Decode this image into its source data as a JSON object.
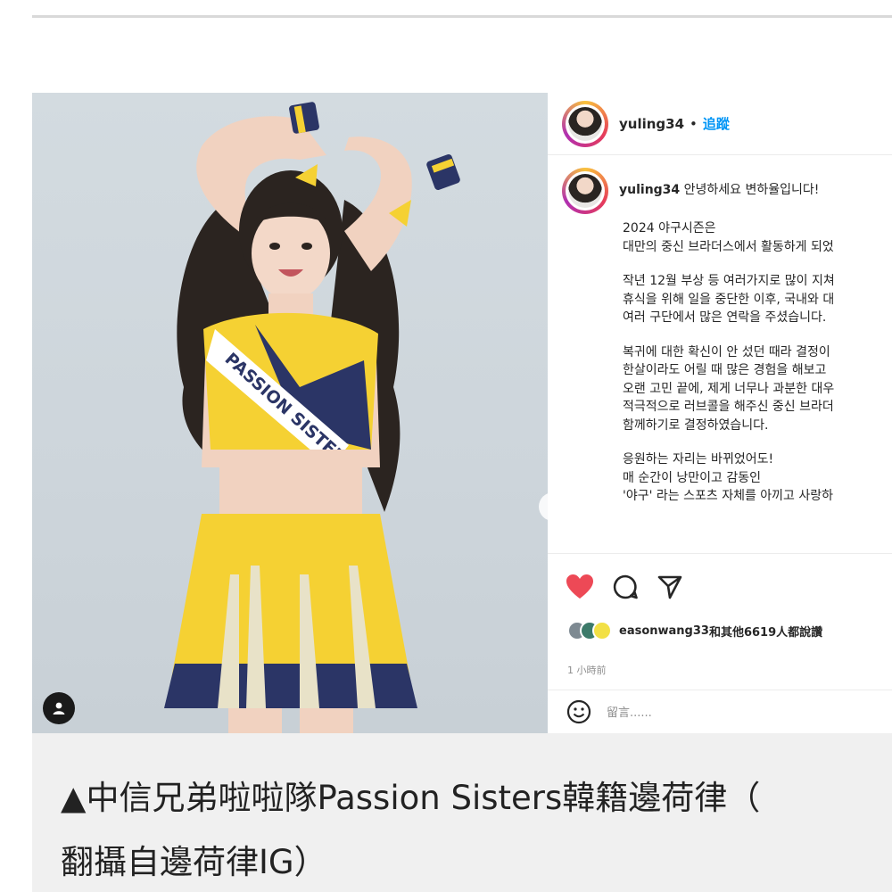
{
  "post": {
    "username": "yuling34",
    "separator": "•",
    "follow_label": "追蹤",
    "caption_greeting": "안녕하세요 변하율입니다!",
    "caption_paragraphs": [
      [
        "2024 야구시즌은",
        "대만의 중신 브라더스에서 활동하게 되었"
      ],
      [
        "작년 12월 부상 등 여러가지로 많이 지쳐",
        "휴식을 위해 일을 중단한 이후, 국내와 대",
        "여러 구단에서 많은 연락을 주셨습니다."
      ],
      [
        "복귀에 대한 확신이 안 섰던 때라 결정이",
        "한살이라도 어릴 때 많은 경험을 해보고",
        "오랜 고민 끝에, 제게 너무나 과분한 대우",
        "적극적으로 러브콜을 해주신 중신 브라더",
        "함께하기로 결정하였습니다."
      ],
      [
        "응원하는 자리는 바뀌었어도!",
        "매 순간이 낭만이고 감동인",
        "'야구' 라는 스포츠 자체를 아끼고 사랑하"
      ]
    ],
    "likes_user": "easonwang33",
    "likes_rest": "和其他6619人都說讚",
    "time_ago": "1 小時前",
    "comment_placeholder": "留言......",
    "icons": [
      "heart-icon",
      "comment-icon",
      "share-icon",
      "emoji-icon",
      "next-arrow-icon",
      "user-tag-icon"
    ],
    "colors": {
      "heart": "#ed4956",
      "follow": "#0095f6"
    }
  },
  "photo": {
    "sash_text": "PASSION SISTERS",
    "colors": {
      "uniform_yellow": "#f5d133",
      "uniform_navy": "#2b3566",
      "background": "#d3dbe0"
    }
  },
  "news_caption": {
    "line1": "▲中信兄弟啦啦隊Passion Sisters韓籍邊荷律（",
    "line2": "翻攝自邊荷律IG）"
  }
}
